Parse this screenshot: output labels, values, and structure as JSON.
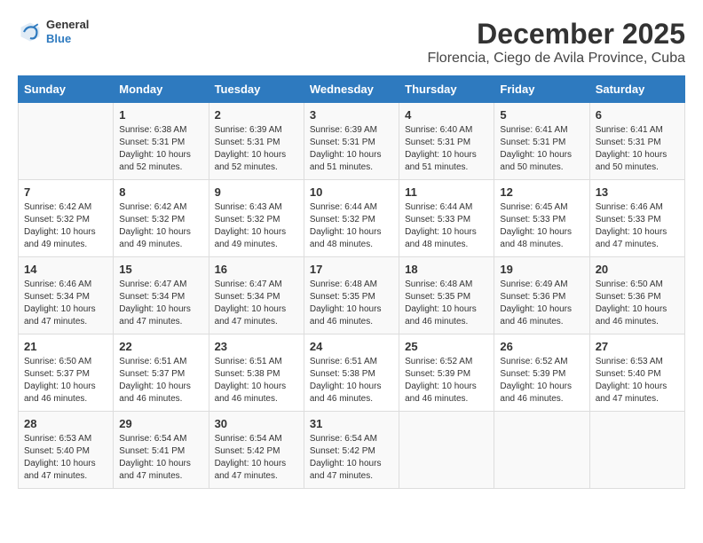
{
  "header": {
    "logo": {
      "line1": "General",
      "line2": "Blue"
    },
    "title": "December 2025",
    "subtitle": "Florencia, Ciego de Avila Province, Cuba"
  },
  "calendar": {
    "days_of_week": [
      "Sunday",
      "Monday",
      "Tuesday",
      "Wednesday",
      "Thursday",
      "Friday",
      "Saturday"
    ],
    "weeks": [
      [
        {
          "day": "",
          "sunrise": "",
          "sunset": "",
          "daylight": ""
        },
        {
          "day": "1",
          "sunrise": "Sunrise: 6:38 AM",
          "sunset": "Sunset: 5:31 PM",
          "daylight": "Daylight: 10 hours and 52 minutes."
        },
        {
          "day": "2",
          "sunrise": "Sunrise: 6:39 AM",
          "sunset": "Sunset: 5:31 PM",
          "daylight": "Daylight: 10 hours and 52 minutes."
        },
        {
          "day": "3",
          "sunrise": "Sunrise: 6:39 AM",
          "sunset": "Sunset: 5:31 PM",
          "daylight": "Daylight: 10 hours and 51 minutes."
        },
        {
          "day": "4",
          "sunrise": "Sunrise: 6:40 AM",
          "sunset": "Sunset: 5:31 PM",
          "daylight": "Daylight: 10 hours and 51 minutes."
        },
        {
          "day": "5",
          "sunrise": "Sunrise: 6:41 AM",
          "sunset": "Sunset: 5:31 PM",
          "daylight": "Daylight: 10 hours and 50 minutes."
        },
        {
          "day": "6",
          "sunrise": "Sunrise: 6:41 AM",
          "sunset": "Sunset: 5:31 PM",
          "daylight": "Daylight: 10 hours and 50 minutes."
        }
      ],
      [
        {
          "day": "7",
          "sunrise": "Sunrise: 6:42 AM",
          "sunset": "Sunset: 5:32 PM",
          "daylight": "Daylight: 10 hours and 49 minutes."
        },
        {
          "day": "8",
          "sunrise": "Sunrise: 6:42 AM",
          "sunset": "Sunset: 5:32 PM",
          "daylight": "Daylight: 10 hours and 49 minutes."
        },
        {
          "day": "9",
          "sunrise": "Sunrise: 6:43 AM",
          "sunset": "Sunset: 5:32 PM",
          "daylight": "Daylight: 10 hours and 49 minutes."
        },
        {
          "day": "10",
          "sunrise": "Sunrise: 6:44 AM",
          "sunset": "Sunset: 5:32 PM",
          "daylight": "Daylight: 10 hours and 48 minutes."
        },
        {
          "day": "11",
          "sunrise": "Sunrise: 6:44 AM",
          "sunset": "Sunset: 5:33 PM",
          "daylight": "Daylight: 10 hours and 48 minutes."
        },
        {
          "day": "12",
          "sunrise": "Sunrise: 6:45 AM",
          "sunset": "Sunset: 5:33 PM",
          "daylight": "Daylight: 10 hours and 48 minutes."
        },
        {
          "day": "13",
          "sunrise": "Sunrise: 6:46 AM",
          "sunset": "Sunset: 5:33 PM",
          "daylight": "Daylight: 10 hours and 47 minutes."
        }
      ],
      [
        {
          "day": "14",
          "sunrise": "Sunrise: 6:46 AM",
          "sunset": "Sunset: 5:34 PM",
          "daylight": "Daylight: 10 hours and 47 minutes."
        },
        {
          "day": "15",
          "sunrise": "Sunrise: 6:47 AM",
          "sunset": "Sunset: 5:34 PM",
          "daylight": "Daylight: 10 hours and 47 minutes."
        },
        {
          "day": "16",
          "sunrise": "Sunrise: 6:47 AM",
          "sunset": "Sunset: 5:34 PM",
          "daylight": "Daylight: 10 hours and 47 minutes."
        },
        {
          "day": "17",
          "sunrise": "Sunrise: 6:48 AM",
          "sunset": "Sunset: 5:35 PM",
          "daylight": "Daylight: 10 hours and 46 minutes."
        },
        {
          "day": "18",
          "sunrise": "Sunrise: 6:48 AM",
          "sunset": "Sunset: 5:35 PM",
          "daylight": "Daylight: 10 hours and 46 minutes."
        },
        {
          "day": "19",
          "sunrise": "Sunrise: 6:49 AM",
          "sunset": "Sunset: 5:36 PM",
          "daylight": "Daylight: 10 hours and 46 minutes."
        },
        {
          "day": "20",
          "sunrise": "Sunrise: 6:50 AM",
          "sunset": "Sunset: 5:36 PM",
          "daylight": "Daylight: 10 hours and 46 minutes."
        }
      ],
      [
        {
          "day": "21",
          "sunrise": "Sunrise: 6:50 AM",
          "sunset": "Sunset: 5:37 PM",
          "daylight": "Daylight: 10 hours and 46 minutes."
        },
        {
          "day": "22",
          "sunrise": "Sunrise: 6:51 AM",
          "sunset": "Sunset: 5:37 PM",
          "daylight": "Daylight: 10 hours and 46 minutes."
        },
        {
          "day": "23",
          "sunrise": "Sunrise: 6:51 AM",
          "sunset": "Sunset: 5:38 PM",
          "daylight": "Daylight: 10 hours and 46 minutes."
        },
        {
          "day": "24",
          "sunrise": "Sunrise: 6:51 AM",
          "sunset": "Sunset: 5:38 PM",
          "daylight": "Daylight: 10 hours and 46 minutes."
        },
        {
          "day": "25",
          "sunrise": "Sunrise: 6:52 AM",
          "sunset": "Sunset: 5:39 PM",
          "daylight": "Daylight: 10 hours and 46 minutes."
        },
        {
          "day": "26",
          "sunrise": "Sunrise: 6:52 AM",
          "sunset": "Sunset: 5:39 PM",
          "daylight": "Daylight: 10 hours and 46 minutes."
        },
        {
          "day": "27",
          "sunrise": "Sunrise: 6:53 AM",
          "sunset": "Sunset: 5:40 PM",
          "daylight": "Daylight: 10 hours and 47 minutes."
        }
      ],
      [
        {
          "day": "28",
          "sunrise": "Sunrise: 6:53 AM",
          "sunset": "Sunset: 5:40 PM",
          "daylight": "Daylight: 10 hours and 47 minutes."
        },
        {
          "day": "29",
          "sunrise": "Sunrise: 6:54 AM",
          "sunset": "Sunset: 5:41 PM",
          "daylight": "Daylight: 10 hours and 47 minutes."
        },
        {
          "day": "30",
          "sunrise": "Sunrise: 6:54 AM",
          "sunset": "Sunset: 5:42 PM",
          "daylight": "Daylight: 10 hours and 47 minutes."
        },
        {
          "day": "31",
          "sunrise": "Sunrise: 6:54 AM",
          "sunset": "Sunset: 5:42 PM",
          "daylight": "Daylight: 10 hours and 47 minutes."
        },
        {
          "day": "",
          "sunrise": "",
          "sunset": "",
          "daylight": ""
        },
        {
          "day": "",
          "sunrise": "",
          "sunset": "",
          "daylight": ""
        },
        {
          "day": "",
          "sunrise": "",
          "sunset": "",
          "daylight": ""
        }
      ]
    ]
  }
}
